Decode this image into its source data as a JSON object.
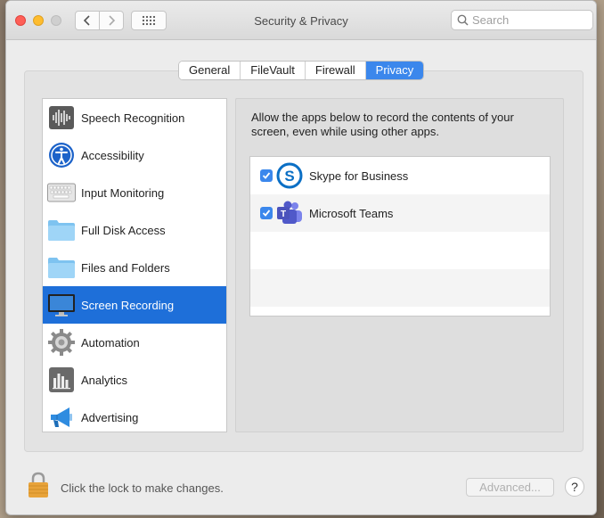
{
  "window": {
    "title": "Security & Privacy",
    "search": {
      "placeholder": "Search",
      "value": ""
    },
    "nav": {
      "back_icon": "chevron-left-icon",
      "forward_icon": "chevron-right-icon",
      "grid_icon": "grid-icon"
    }
  },
  "tabs": [
    {
      "label": "General",
      "active": false
    },
    {
      "label": "FileVault",
      "active": false
    },
    {
      "label": "Firewall",
      "active": false
    },
    {
      "label": "Privacy",
      "active": true
    }
  ],
  "categories": [
    {
      "label": "Speech Recognition",
      "icon": "waveform-icon",
      "selected": false
    },
    {
      "label": "Accessibility",
      "icon": "accessibility-icon",
      "selected": false
    },
    {
      "label": "Input Monitoring",
      "icon": "keyboard-icon",
      "selected": false
    },
    {
      "label": "Full Disk Access",
      "icon": "folder-icon",
      "selected": false
    },
    {
      "label": "Files and Folders",
      "icon": "folder-icon",
      "selected": false
    },
    {
      "label": "Screen Recording",
      "icon": "display-icon",
      "selected": true
    },
    {
      "label": "Automation",
      "icon": "gear-icon",
      "selected": false
    },
    {
      "label": "Analytics",
      "icon": "bar-chart-icon",
      "selected": false
    },
    {
      "label": "Advertising",
      "icon": "megaphone-icon",
      "selected": false
    }
  ],
  "content": {
    "description": "Allow the apps below to record the contents of your screen, even while using other apps.",
    "apps": [
      {
        "label": "Skype for Business",
        "icon": "skype-icon",
        "checked": true
      },
      {
        "label": "Microsoft Teams",
        "icon": "teams-icon",
        "checked": true
      }
    ]
  },
  "footer": {
    "lock_text": "Click the lock to make changes.",
    "advanced_label": "Advanced...",
    "help_label": "?"
  },
  "colors": {
    "accent": "#3b87ec",
    "selection": "#1e6fd9"
  }
}
